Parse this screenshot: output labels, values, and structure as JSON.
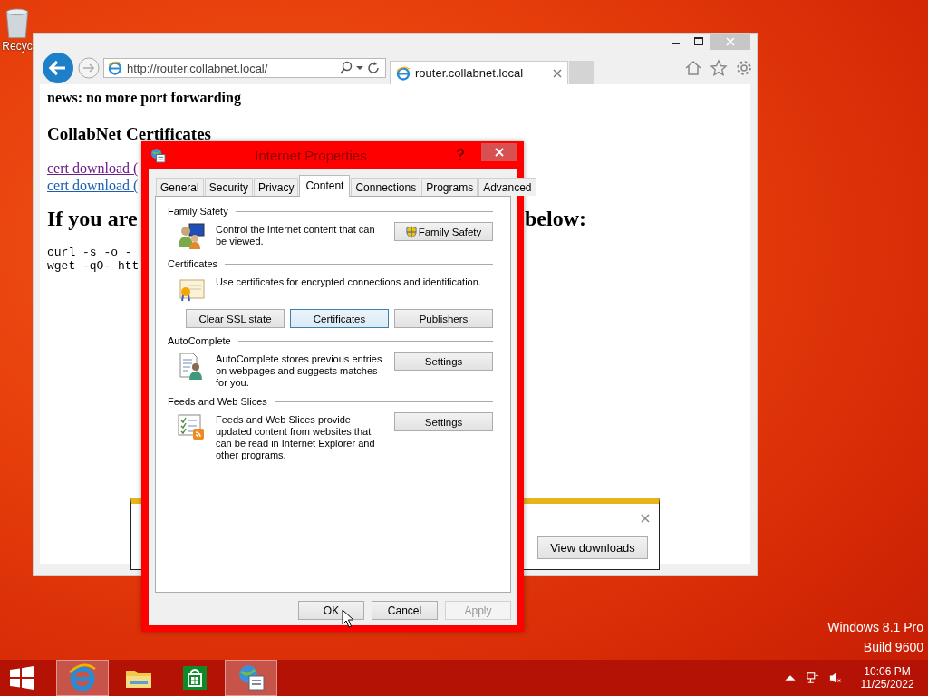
{
  "desktop": {
    "recycle_bin_label": "Recyc",
    "edition_lines": [
      "Windows 8.1 Pro",
      "Build 9600"
    ]
  },
  "browser": {
    "address": "http://router.collabnet.local/",
    "tabs": [
      {
        "title": "router.collabnet.local",
        "selected": true
      }
    ],
    "page": {
      "news": "news: no more port forwarding",
      "heading": "CollabNet Certificates",
      "links": [
        {
          "text": "cert download (",
          "visited": true
        },
        {
          "text": "cert download (",
          "visited": false
        }
      ],
      "big_heading_left": "If you are",
      "big_heading_right": "below:",
      "code_lines": [
        "curl -s -o -",
        "wget -qO- htt"
      ]
    }
  },
  "download_bar": {
    "button": "View downloads"
  },
  "dialog": {
    "title": "Internet Properties",
    "tabs": [
      {
        "label": "General",
        "selected": false
      },
      {
        "label": "Security",
        "selected": false
      },
      {
        "label": "Privacy",
        "selected": false
      },
      {
        "label": "Content",
        "selected": true
      },
      {
        "label": "Connections",
        "selected": false
      },
      {
        "label": "Programs",
        "selected": false
      },
      {
        "label": "Advanced",
        "selected": false
      }
    ],
    "sections": [
      {
        "title": "Family Safety",
        "kind": "family",
        "text": "Control the Internet content that can be viewed.",
        "buttons": [
          {
            "label": "Family Safety",
            "focused": false
          }
        ]
      },
      {
        "title": "Certificates",
        "kind": "certificates",
        "text": "Use certificates for encrypted connections and identification.",
        "buttons": [
          {
            "label": "Clear SSL state",
            "focused": false
          },
          {
            "label": "Certificates",
            "focused": true
          },
          {
            "label": "Publishers",
            "focused": false
          }
        ]
      },
      {
        "title": "AutoComplete",
        "kind": "autocomplete",
        "text": "AutoComplete stores previous entries on webpages and suggests matches for you.",
        "buttons": [
          {
            "label": "Settings",
            "focused": false
          }
        ]
      },
      {
        "title": "Feeds and Web Slices",
        "kind": "feeds",
        "text": "Feeds and Web Slices provide updated content from websites that can be read in Internet Explorer and other programs.",
        "buttons": [
          {
            "label": "Settings",
            "focused": false
          }
        ]
      }
    ],
    "buttons": [
      {
        "label": "OK",
        "disabled": false
      },
      {
        "label": "Cancel",
        "disabled": false
      },
      {
        "label": "Apply",
        "disabled": true
      }
    ]
  },
  "taskbar": {
    "items": [
      {
        "kind": "ie",
        "active": true
      },
      {
        "kind": "explorer",
        "active": false
      },
      {
        "kind": "store",
        "active": false
      },
      {
        "kind": "internet-options",
        "active": true
      }
    ],
    "time": "10:06 PM",
    "date": "11/25/2022"
  }
}
